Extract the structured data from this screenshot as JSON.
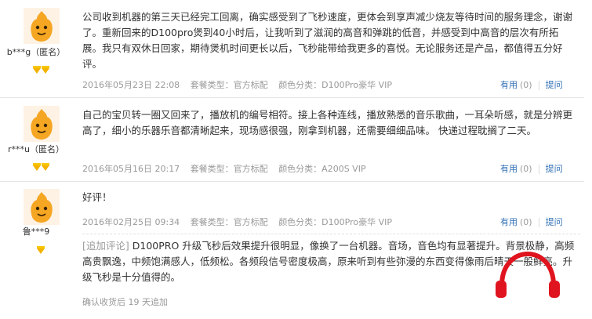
{
  "reviews": [
    {
      "username": "b***g（匿名）",
      "content": "公司收到机器的第三天已经完工回离，确实感受到了飞秒速度，更体会到享声减少烧友等待时间的服务理念，谢谢了。重新回来的D100pro煲到40小时后，让我听到了滋润的高音和弹跳的低音，并感受到中高音的层次有所拓展。我只有双休日回家，期待煲机时间更长以后，飞秒能带给我更多的喜悦。无论服务还是产品，都值得五分好评。",
      "date": "2016年05月23日 22:08",
      "package": "套餐类型：官方标配",
      "color": "颜色分类：D100Pro豪华 VIP",
      "useful": "有用",
      "count": "(0)",
      "ask": "提问"
    },
    {
      "username": "r***u（匿名）",
      "content": "自己的宝贝转一圈又回来了，播放机的编号相符。接上各种连线，播放熟悉的音乐歌曲，一耳朵听感，就是分辨更高了，细小的乐器乐音都清晰起来，现场感很强，刚拿到机器，还需要细细品味。 快递过程耽搁了二天。",
      "date": "2016年05月16日 20:17",
      "package": "套餐类型：官方标配",
      "color": "颜色分类：A200S VIP",
      "useful": "有用",
      "count": "(0)",
      "ask": "提问"
    },
    {
      "username": "鲁***9",
      "content": "好评！",
      "date": "2016年02月25日 09:34",
      "package": "套餐类型：官方标配",
      "color": "颜色分类：D100Pro豪华 VIP",
      "useful": "有用",
      "count": "(0)",
      "ask": "提问",
      "followup_tag": "[追加评论]",
      "followup": " D100PRO 升级飞秒后效果提升很明显，像换了一台机器。音场，音色均有显著提升。背景极静，高频高贵飘逸，中频饱满感人，低频松。各频段信号密度极高，原来听到有些弥漫的东西变得像雨后晴天一般鲜亮。升级飞秒是十分值得的。",
      "followup_meta": "确认收货后 19 天追加"
    }
  ],
  "colors": {
    "link": "#2f6fb5",
    "meta": "#999999",
    "avatar": "#f5a623",
    "watermark": "#e0141e"
  }
}
